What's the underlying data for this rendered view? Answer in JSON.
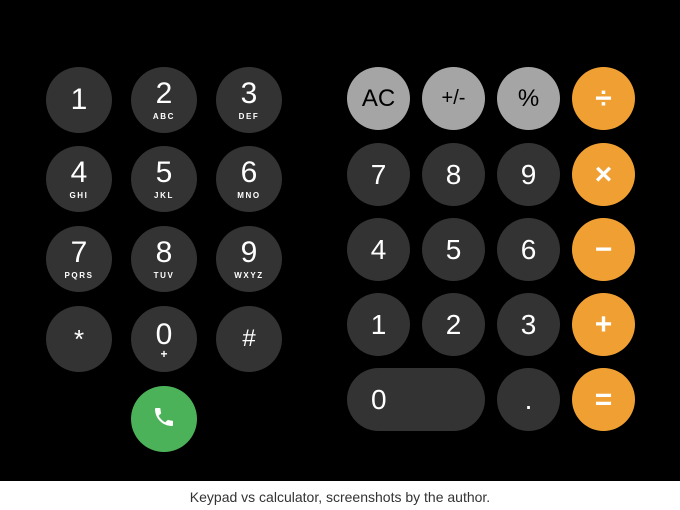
{
  "keypad": {
    "keys": [
      {
        "digit": "1",
        "letters": ""
      },
      {
        "digit": "2",
        "letters": "ABC"
      },
      {
        "digit": "3",
        "letters": "DEF"
      },
      {
        "digit": "4",
        "letters": "GHI"
      },
      {
        "digit": "5",
        "letters": "JKL"
      },
      {
        "digit": "6",
        "letters": "MNO"
      },
      {
        "digit": "7",
        "letters": "PQRS"
      },
      {
        "digit": "8",
        "letters": "TUV"
      },
      {
        "digit": "9",
        "letters": "WXYZ"
      },
      {
        "digit": "*",
        "letters": ""
      },
      {
        "digit": "0",
        "letters": "+"
      },
      {
        "digit": "#",
        "letters": ""
      }
    ],
    "call_icon": "phone-icon",
    "call_color": "#4cb25a"
  },
  "calculator": {
    "row1": [
      "AC",
      "+/-",
      "%",
      "÷"
    ],
    "row2": [
      "7",
      "8",
      "9",
      "×"
    ],
    "row3": [
      "4",
      "5",
      "6",
      "−"
    ],
    "row4": [
      "1",
      "2",
      "3",
      "+"
    ],
    "row5": [
      "0",
      ".",
      "="
    ],
    "colors": {
      "digit": "#333333",
      "function": "#a5a5a5",
      "operator": "#f0a032"
    }
  },
  "caption": "Keypad vs calculator, screenshots by the author."
}
